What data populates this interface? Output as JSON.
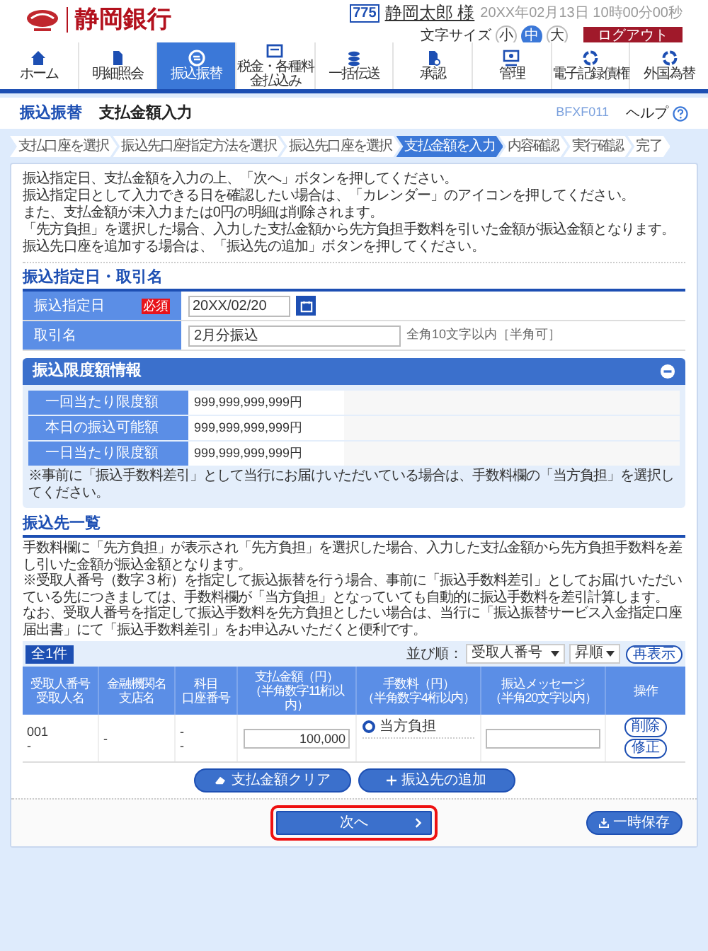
{
  "header": {
    "bank_name": "静岡銀行",
    "user_badge": "775",
    "user_name": "静岡太郎 様",
    "datetime": "20XX年02月13日 10時00分00秒",
    "font_size_label": "文字サイズ",
    "font_sizes": [
      {
        "label": "小",
        "selected": false
      },
      {
        "label": "中",
        "selected": true
      },
      {
        "label": "大",
        "selected": false
      }
    ],
    "logout": "ログアウト"
  },
  "nav": [
    {
      "kind": "home",
      "label": "ホーム",
      "selected": false
    },
    {
      "kind": "document",
      "label": "明細照会",
      "selected": false
    },
    {
      "kind": "transfer",
      "label": "振込振替",
      "selected": true
    },
    {
      "kind": "bill",
      "label": "税金・各種料金払込み",
      "selected": false
    },
    {
      "kind": "stack",
      "label": "一括伝送",
      "selected": false
    },
    {
      "kind": "approve",
      "label": "承認",
      "selected": false
    },
    {
      "kind": "admin",
      "label": "管理",
      "selected": false
    },
    {
      "kind": "ring",
      "label": "電子記録債権",
      "selected": false
    },
    {
      "kind": "ring",
      "label": "外国為替",
      "selected": false
    }
  ],
  "page": {
    "section": "振込振替",
    "title": "支払金額入力",
    "screen_id": "BFXF011",
    "help": "ヘルプ"
  },
  "steps": [
    {
      "label": "支払口座を選択",
      "selected": false
    },
    {
      "label": "振込先口座指定方法を選択",
      "selected": false
    },
    {
      "label": "振込先口座を選択",
      "selected": false
    },
    {
      "label": "支払金額を入力",
      "selected": true
    },
    {
      "label": "内容確認",
      "selected": false
    },
    {
      "label": "実行確認",
      "selected": false
    },
    {
      "label": "完了",
      "selected": false
    }
  ],
  "instructions": [
    "振込指定日、支払金額を入力の上、「次へ」ボタンを押してください。",
    "振込指定日として入力できる日を確認したい場合は、「カレンダー」のアイコンを押してください。",
    "また、支払金額が未入力または0円の明細は削除されます。",
    "「先方負担」を選択した場合、入力した支払金額から先方負担手数料を引いた金額が振込金額となります。",
    "振込先口座を追加する場合は、「振込先の追加」ボタンを押してください。"
  ],
  "transfer_info": {
    "heading": "振込指定日・取引名",
    "date": {
      "label": "振込指定日",
      "required": "必須",
      "value": "20XX/02/20"
    },
    "name": {
      "label": "取引名",
      "value": "2月分振込",
      "hint": "全角10文字以内［半角可］"
    }
  },
  "limits": {
    "heading": "振込限度額情報",
    "expanded": true,
    "rows": [
      {
        "label": "一回当たり限度額",
        "value": "999,999,999,999円"
      },
      {
        "label": "本日の振込可能額",
        "value": "999,999,999,999円"
      },
      {
        "label": "一日当たり限度額",
        "value": "999,999,999,999円"
      }
    ],
    "note": "※事前に「振込手数料差引」として当行にお届けいただいている場合は、手数料欄の「当方負担」を選択してください。"
  },
  "payees": {
    "heading": "振込先一覧",
    "notes": [
      "手数料欄に「先方負担」が表示され「先方負担」を選択した場合、入力した支払金額から先方負担手数料を差し引いた金額が振込金額となります。",
      "※受取人番号（数字３桁）を指定して振込振替を行う場合、事前に「振込手数料差引」としてお届けいただいている先につきましては、手数料欄が「当方負担」となっていても自動的に振込手数料を差引計算します。",
      "なお、受取人番号を指定して振込手数料を先方負担としたい場合は、当行に「振込振替サービス入金指定口座届出書」にて「振込手数料差引」をお申込みいただくと便利です。"
    ],
    "count": "全1件",
    "sort_label": "並び順：",
    "sort_field": "受取人番号",
    "sort_order": "昇順",
    "redisplay": "再表示",
    "columns": [
      [
        "受取人番号",
        "受取人名"
      ],
      [
        "金融機関名",
        "支店名"
      ],
      [
        "科目",
        "口座番号"
      ],
      [
        "支払金額（円）",
        "（半角数字11桁以内）"
      ],
      [
        "手数料（円）",
        "（半角数字4桁以内）"
      ],
      [
        "振込メッセージ",
        "（半角20文字以内）"
      ],
      [
        "操作"
      ]
    ],
    "rows": [
      {
        "payee_number": "001",
        "payee_name": "-",
        "bank": "-",
        "account_type": "-",
        "account_number": "-",
        "amount": "100,000",
        "fee_options": [
          {
            "label": "当方負担",
            "selected": true
          }
        ],
        "actions": [
          "削除",
          "修正"
        ]
      }
    ],
    "clear_button": "支払金額クリア",
    "add_button": "振込先の追加"
  },
  "footer": {
    "next": {
      "label": "次へ",
      "highlighted": true
    },
    "save": "一時保存"
  }
}
